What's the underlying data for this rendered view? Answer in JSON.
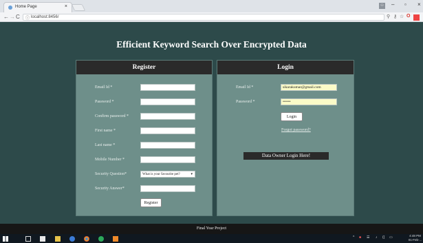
{
  "browser": {
    "tab_title": "Home Page",
    "tab_close": "×",
    "url": "localhost:8456/",
    "nav_back": "←",
    "nav_forward": "→",
    "nav_reload": "C",
    "window_minimize": "–",
    "window_maximize": "▫",
    "window_close": "×"
  },
  "page": {
    "title": "Efficient Keyword Search Over Encrypted Data",
    "footer": "Final Year Project"
  },
  "register": {
    "heading": "Register",
    "labels": {
      "email": "Email Id *",
      "password": "Password *",
      "confirm_password": "Confirm password *",
      "first_name": "First name *",
      "last_name": "Last name *",
      "mobile": "Mobile Number *",
      "security_question": "Security Question*",
      "security_answer": "Security Answer*"
    },
    "security_question_selected": "What is your favourite pet?",
    "submit": "Register"
  },
  "login": {
    "heading": "Login",
    "email_label": "Email Id *",
    "password_label": "Password *",
    "email_value": "sikarakumar@gmail.com",
    "password_value": "••••••",
    "submit": "Login",
    "forgot": "Forgot password?",
    "owner_button": "Data Owner Login Here!"
  },
  "taskbar": {
    "time": "4:48 PM",
    "date": "01-Feb-..."
  },
  "colors": {
    "page_bg": "#2d4a4a",
    "panel_bg": "#6e8f8a",
    "panel_header": "#2a2a2a",
    "autofill": "#fbfbc8"
  }
}
